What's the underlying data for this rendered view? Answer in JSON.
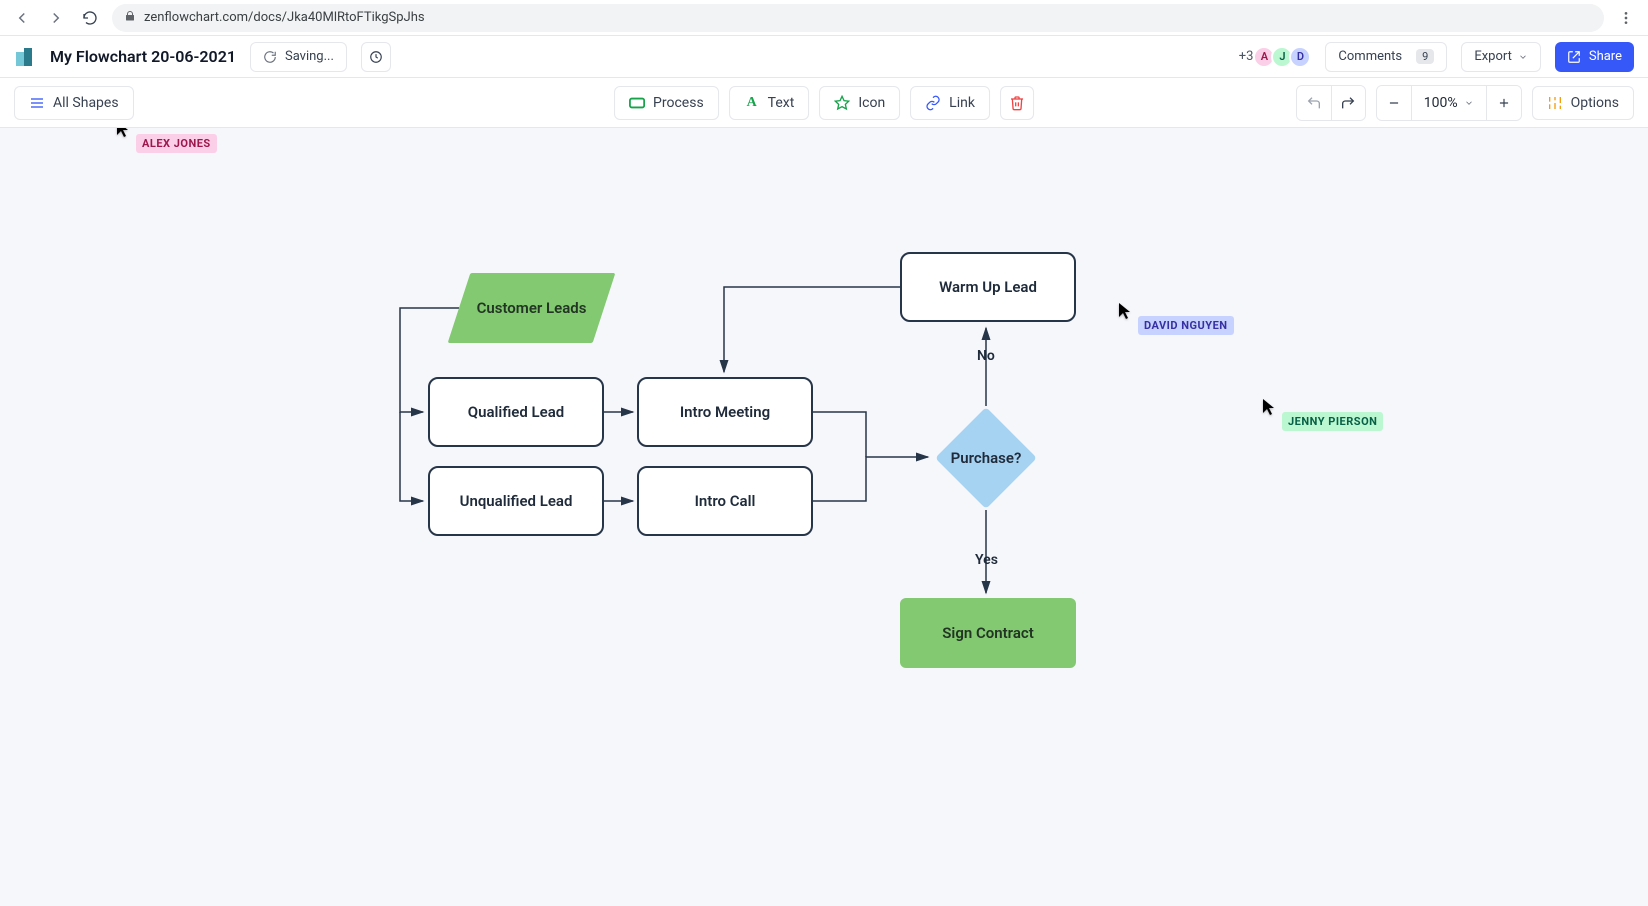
{
  "browser": {
    "url": "zenflowchart.com/docs/Jka40MlRtoFTikgSpJhs"
  },
  "app": {
    "doc_title": "My Flowchart 20-06-2021",
    "saving_label": "Saving...",
    "presence_more": "+3",
    "presence_avatars": [
      "A",
      "J",
      "D"
    ],
    "comments_label": "Comments",
    "comments_count": "9",
    "export_label": "Export",
    "share_label": "Share"
  },
  "toolbar": {
    "all_shapes_label": "All Shapes",
    "process_label": "Process",
    "text_label": "Text",
    "icon_label": "Icon",
    "link_label": "Link",
    "zoom_value": "100%",
    "options_label": "Options"
  },
  "cursors": {
    "alex": "ALEX JONES",
    "david": "DAVID NGUYEN",
    "jenny": "JENNY PIERSON"
  },
  "nodes": {
    "customer_leads": "Customer Leads",
    "qualified_lead": "Qualified Lead",
    "unqualified_lead": "Unqualified Lead",
    "intro_meeting": "Intro Meeting",
    "intro_call": "Intro Call",
    "warm_up_lead": "Warm Up Lead",
    "purchase": "Purchase?",
    "sign_contract": "Sign Contract"
  },
  "edge_labels": {
    "no": "No",
    "yes": "Yes"
  }
}
